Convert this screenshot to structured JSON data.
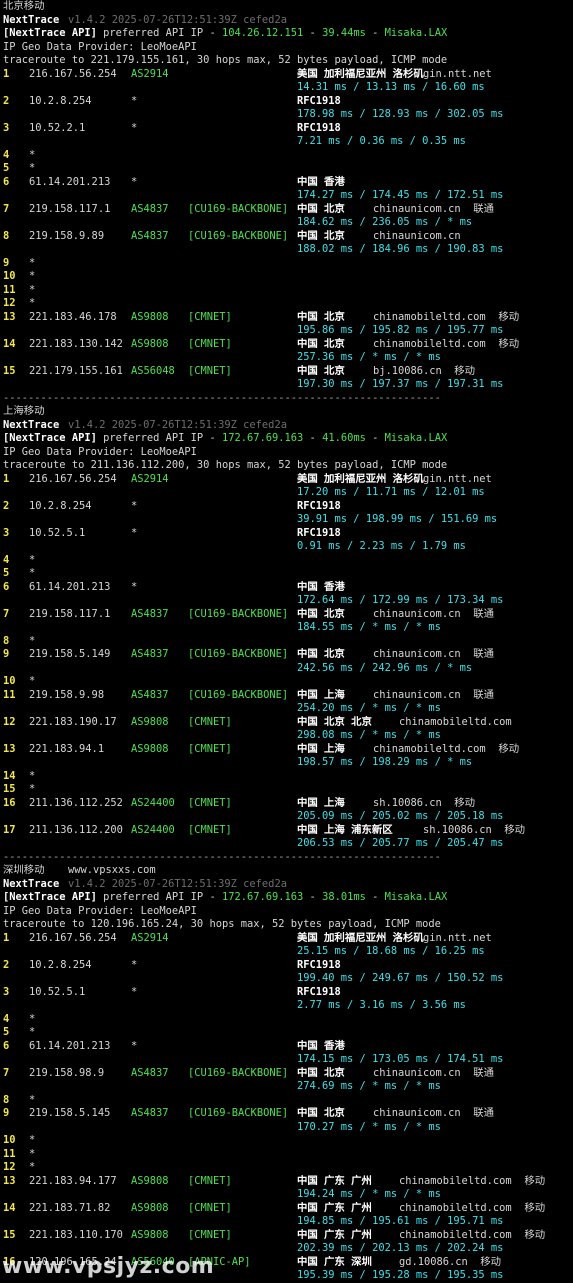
{
  "sections": [
    {
      "title": "北京移动",
      "title_extra": "",
      "nexttrace": "NextTrace",
      "version": "v1.4.2 2025-07-26T12:51:39Z cefed2a",
      "api_prefix": "[NextTrace API]",
      "api_mid": " preferred API IP - ",
      "api_ip": "104.26.12.151",
      "api_dash1": " - ",
      "api_ms": "39.44ms",
      "api_dash2": " - ",
      "api_node": "Misaka.LAX",
      "geo": "IP Geo Data Provider: LeoMoeAPI",
      "traceroute": "traceroute to 221.179.155.161, 30 hops max, 52 bytes payload, ICMP mode",
      "hops": [
        {
          "n": "1",
          "ip": "216.167.56.254",
          "asn": "AS2914",
          "tag": "",
          "geo": "美国 加利福尼亚州 洛杉矶",
          "host": "gin.ntt.net",
          "isp": "",
          "rtt": "14.31 ms / 13.13 ms / 16.60 ms"
        },
        {
          "n": "2",
          "ip": "10.2.8.254",
          "asn": "*",
          "tag": "",
          "geo": "RFC1918",
          "host": "",
          "isp": "",
          "rtt": "178.98 ms / 128.93 ms / 302.05 ms"
        },
        {
          "n": "3",
          "ip": "10.52.2.1",
          "asn": "*",
          "tag": "",
          "geo": "RFC1918",
          "host": "",
          "isp": "",
          "rtt": "7.21 ms / 0.36 ms / 0.35 ms"
        },
        {
          "n": "4",
          "ip": "*",
          "asn": "",
          "tag": "",
          "geo": "",
          "host": "",
          "isp": "",
          "rtt": ""
        },
        {
          "n": "5",
          "ip": "*",
          "asn": "",
          "tag": "",
          "geo": "",
          "host": "",
          "isp": "",
          "rtt": ""
        },
        {
          "n": "6",
          "ip": "61.14.201.213",
          "asn": "*",
          "tag": "",
          "geo": "中国 香港",
          "host": "",
          "isp": "",
          "rtt": "174.27 ms / 174.45 ms / 172.51 ms"
        },
        {
          "n": "7",
          "ip": "219.158.117.1",
          "asn": "AS4837",
          "tag": "[CU169-BACKBONE]",
          "geo": "中国 北京",
          "host": "chinaunicom.cn",
          "isp": "联通",
          "rtt": "184.62 ms / 236.05 ms / * ms"
        },
        {
          "n": "8",
          "ip": "219.158.9.89",
          "asn": "AS4837",
          "tag": "[CU169-BACKBONE]",
          "geo": "中国 北京",
          "host": "chinaunicom.cn",
          "isp": "",
          "rtt": "188.02 ms / 184.96 ms / 190.83 ms"
        },
        {
          "n": "9",
          "ip": "*",
          "asn": "",
          "tag": "",
          "geo": "",
          "host": "",
          "isp": "",
          "rtt": ""
        },
        {
          "n": "10",
          "ip": "*",
          "asn": "",
          "tag": "",
          "geo": "",
          "host": "",
          "isp": "",
          "rtt": ""
        },
        {
          "n": "11",
          "ip": "*",
          "asn": "",
          "tag": "",
          "geo": "",
          "host": "",
          "isp": "",
          "rtt": ""
        },
        {
          "n": "12",
          "ip": "*",
          "asn": "",
          "tag": "",
          "geo": "",
          "host": "",
          "isp": "",
          "rtt": ""
        },
        {
          "n": "13",
          "ip": "221.183.46.178",
          "asn": "AS9808",
          "tag": "[CMNET]",
          "geo": "中国 北京",
          "host": "chinamobileltd.com",
          "isp": "移动",
          "rtt": "195.86 ms / 195.82 ms / 195.77 ms"
        },
        {
          "n": "14",
          "ip": "221.183.130.142",
          "asn": "AS9808",
          "tag": "[CMNET]",
          "geo": "中国 北京",
          "host": "chinamobileltd.com",
          "isp": "移动",
          "rtt": "257.36 ms / * ms / * ms"
        },
        {
          "n": "15",
          "ip": "221.179.155.161",
          "asn": "AS56048",
          "tag": "[CMNET]",
          "geo": "中国 北京",
          "host": "bj.10086.cn",
          "isp": "移动",
          "rtt": "197.30 ms / 197.37 ms / 197.31 ms"
        }
      ]
    },
    {
      "title": "上海移动",
      "title_extra": "",
      "nexttrace": "NextTrace",
      "version": "v1.4.2 2025-07-26T12:51:39Z cefed2a",
      "api_prefix": "[NextTrace API]",
      "api_mid": " preferred API IP - ",
      "api_ip": "172.67.69.163",
      "api_dash1": " - ",
      "api_ms": "41.60ms",
      "api_dash2": " - ",
      "api_node": "Misaka.LAX",
      "geo": "IP Geo Data Provider: LeoMoeAPI",
      "traceroute": "traceroute to 211.136.112.200, 30 hops max, 52 bytes payload, ICMP mode",
      "hops": [
        {
          "n": "1",
          "ip": "216.167.56.254",
          "asn": "AS2914",
          "tag": "",
          "geo": "美国 加利福尼亚州 洛杉矶",
          "host": "gin.ntt.net",
          "isp": "",
          "rtt": "17.20 ms / 11.71 ms / 12.01 ms"
        },
        {
          "n": "2",
          "ip": "10.2.8.254",
          "asn": "*",
          "tag": "",
          "geo": "RFC1918",
          "host": "",
          "isp": "",
          "rtt": "39.91 ms / 198.99 ms / 151.69 ms"
        },
        {
          "n": "3",
          "ip": "10.52.5.1",
          "asn": "*",
          "tag": "",
          "geo": "RFC1918",
          "host": "",
          "isp": "",
          "rtt": "0.91 ms / 2.23 ms / 1.79 ms"
        },
        {
          "n": "4",
          "ip": "*",
          "asn": "",
          "tag": "",
          "geo": "",
          "host": "",
          "isp": "",
          "rtt": ""
        },
        {
          "n": "5",
          "ip": "*",
          "asn": "",
          "tag": "",
          "geo": "",
          "host": "",
          "isp": "",
          "rtt": ""
        },
        {
          "n": "6",
          "ip": "61.14.201.213",
          "asn": "*",
          "tag": "",
          "geo": "中国 香港",
          "host": "",
          "isp": "",
          "rtt": "172.64 ms / 172.99 ms / 173.34 ms"
        },
        {
          "n": "7",
          "ip": "219.158.117.1",
          "asn": "AS4837",
          "tag": "[CU169-BACKBONE]",
          "geo": "中国 北京",
          "host": "chinaunicom.cn",
          "isp": "联通",
          "rtt": "184.55 ms / * ms / * ms"
        },
        {
          "n": "8",
          "ip": "*",
          "asn": "",
          "tag": "",
          "geo": "",
          "host": "",
          "isp": "",
          "rtt": ""
        },
        {
          "n": "9",
          "ip": "219.158.5.149",
          "asn": "AS4837",
          "tag": "[CU169-BACKBONE]",
          "geo": "中国 北京",
          "host": "chinaunicom.cn",
          "isp": "联通",
          "rtt": "242.56 ms / 242.96 ms / * ms"
        },
        {
          "n": "10",
          "ip": "*",
          "asn": "",
          "tag": "",
          "geo": "",
          "host": "",
          "isp": "",
          "rtt": ""
        },
        {
          "n": "11",
          "ip": "219.158.9.98",
          "asn": "AS4837",
          "tag": "[CU169-BACKBONE]",
          "geo": "中国 上海",
          "host": "chinaunicom.cn",
          "isp": "联通",
          "rtt": "254.20 ms / * ms / * ms"
        },
        {
          "n": "12",
          "ip": "221.183.190.17",
          "asn": "AS9808",
          "tag": "[CMNET]",
          "geo": "中国 北京 北京",
          "host": "chinamobileltd.com",
          "isp": "",
          "rtt": "298.08 ms / * ms / * ms"
        },
        {
          "n": "13",
          "ip": "221.183.94.1",
          "asn": "AS9808",
          "tag": "[CMNET]",
          "geo": "中国 上海",
          "host": "chinamobileltd.com",
          "isp": "移动",
          "rtt": "198.57 ms / 198.29 ms / * ms"
        },
        {
          "n": "14",
          "ip": "*",
          "asn": "",
          "tag": "",
          "geo": "",
          "host": "",
          "isp": "",
          "rtt": ""
        },
        {
          "n": "15",
          "ip": "*",
          "asn": "",
          "tag": "",
          "geo": "",
          "host": "",
          "isp": "",
          "rtt": ""
        },
        {
          "n": "16",
          "ip": "211.136.112.252",
          "asn": "AS24400",
          "tag": "[CMNET]",
          "geo": "中国 上海",
          "host": "sh.10086.cn",
          "isp": "移动",
          "rtt": "205.09 ms / 205.02 ms / 205.18 ms"
        },
        {
          "n": "17",
          "ip": "211.136.112.200",
          "asn": "AS24400",
          "tag": "[CMNET]",
          "geo": "中国 上海 浦东新区",
          "host": "sh.10086.cn",
          "isp": "移动",
          "rtt": "206.53 ms / 205.77 ms / 205.47 ms"
        }
      ]
    },
    {
      "title": "深圳移动",
      "title_extra": "www.vpsxxs.com",
      "nexttrace": "NextTrace",
      "version": "v1.4.2 2025-07-26T12:51:39Z cefed2a",
      "api_prefix": "[NextTrace API]",
      "api_mid": " preferred API IP - ",
      "api_ip": "172.67.69.163",
      "api_dash1": " - ",
      "api_ms": "38.01ms",
      "api_dash2": " - ",
      "api_node": "Misaka.LAX",
      "geo": "IP Geo Data Provider: LeoMoeAPI",
      "traceroute": "traceroute to 120.196.165.24, 30 hops max, 52 bytes payload, ICMP mode",
      "hops": [
        {
          "n": "1",
          "ip": "216.167.56.254",
          "asn": "AS2914",
          "tag": "",
          "geo": "美国 加利福尼亚州 洛杉矶",
          "host": "gin.ntt.net",
          "isp": "",
          "rtt": "25.15 ms / 18.68 ms / 16.25 ms"
        },
        {
          "n": "2",
          "ip": "10.2.8.254",
          "asn": "*",
          "tag": "",
          "geo": "RFC1918",
          "host": "",
          "isp": "",
          "rtt": "199.40 ms / 249.67 ms / 150.52 ms"
        },
        {
          "n": "3",
          "ip": "10.52.5.1",
          "asn": "*",
          "tag": "",
          "geo": "RFC1918",
          "host": "",
          "isp": "",
          "rtt": "2.77 ms / 3.16 ms / 3.56 ms"
        },
        {
          "n": "4",
          "ip": "*",
          "asn": "",
          "tag": "",
          "geo": "",
          "host": "",
          "isp": "",
          "rtt": ""
        },
        {
          "n": "5",
          "ip": "*",
          "asn": "",
          "tag": "",
          "geo": "",
          "host": "",
          "isp": "",
          "rtt": ""
        },
        {
          "n": "6",
          "ip": "61.14.201.213",
          "asn": "*",
          "tag": "",
          "geo": "中国 香港",
          "host": "",
          "isp": "",
          "rtt": "174.15 ms / 173.05 ms / 174.51 ms"
        },
        {
          "n": "7",
          "ip": "219.158.98.9",
          "asn": "AS4837",
          "tag": "[CU169-BACKBONE]",
          "geo": "中国 北京",
          "host": "chinaunicom.cn",
          "isp": "联通",
          "rtt": "274.69 ms / * ms / * ms"
        },
        {
          "n": "8",
          "ip": "*",
          "asn": "",
          "tag": "",
          "geo": "",
          "host": "",
          "isp": "",
          "rtt": ""
        },
        {
          "n": "9",
          "ip": "219.158.5.145",
          "asn": "AS4837",
          "tag": "[CU169-BACKBONE]",
          "geo": "中国 北京",
          "host": "chinaunicom.cn",
          "isp": "联通",
          "rtt": "170.27 ms / * ms / * ms"
        },
        {
          "n": "10",
          "ip": "*",
          "asn": "",
          "tag": "",
          "geo": "",
          "host": "",
          "isp": "",
          "rtt": ""
        },
        {
          "n": "11",
          "ip": "*",
          "asn": "",
          "tag": "",
          "geo": "",
          "host": "",
          "isp": "",
          "rtt": ""
        },
        {
          "n": "12",
          "ip": "*",
          "asn": "",
          "tag": "",
          "geo": "",
          "host": "",
          "isp": "",
          "rtt": ""
        },
        {
          "n": "13",
          "ip": "221.183.94.177",
          "asn": "AS9808",
          "tag": "[CMNET]",
          "geo": "中国 广东 广州",
          "host": "chinamobileltd.com",
          "isp": "移动",
          "rtt": "194.24 ms / * ms / * ms"
        },
        {
          "n": "14",
          "ip": "221.183.71.82",
          "asn": "AS9808",
          "tag": "[CMNET]",
          "geo": "中国 广东 广州",
          "host": "chinamobileltd.com",
          "isp": "移动",
          "rtt": "194.85 ms / 195.61 ms / 195.71 ms"
        },
        {
          "n": "15",
          "ip": "221.183.110.170",
          "asn": "AS9808",
          "tag": "[CMNET]",
          "geo": "中国 广东 广州",
          "host": "chinamobileltd.com",
          "isp": "移动",
          "rtt": "202.39 ms / 202.13 ms / 202.24 ms"
        },
        {
          "n": "16",
          "ip": "120.196.165.24",
          "asn": "AS56040",
          "tag": "[APNIC-AP]",
          "geo": "中国 广东 深圳",
          "host": "gd.10086.cn",
          "isp": "移动",
          "rtt": "195.39 ms / 195.28 ms / 195.35 ms"
        }
      ]
    }
  ],
  "separator": "----------------------------------------------------------------------",
  "watermark": "www.vpsjyz.com",
  "colors": {
    "hop_number": "#f2e64a",
    "asn": "#4ee04e",
    "rtt": "#3fe0e8",
    "version": "#6e6e6e",
    "background": "#000000"
  }
}
